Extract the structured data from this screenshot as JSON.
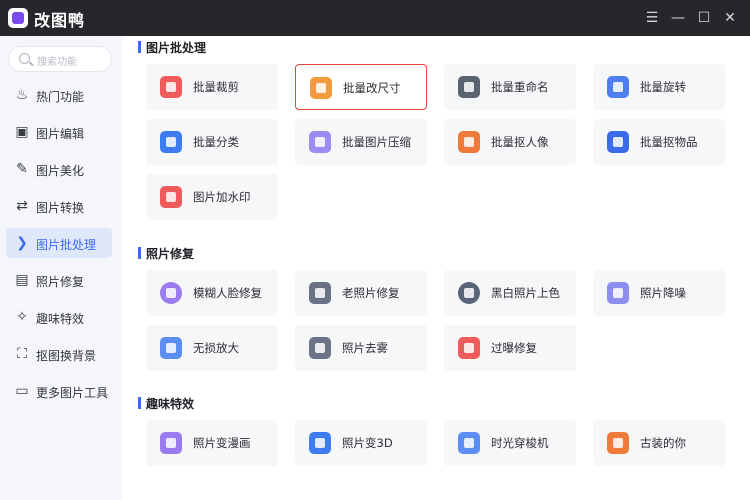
{
  "app": {
    "title": "改图鸭"
  },
  "window_controls": {
    "menu": "☰",
    "minimize": "—",
    "maximize": "☐",
    "close": "✕"
  },
  "search": {
    "placeholder": "搜索功能"
  },
  "sidebar": {
    "items": [
      {
        "label": "热门功能",
        "icon": "fire-icon",
        "glyph": "♨"
      },
      {
        "label": "图片编辑",
        "icon": "image-edit-icon",
        "glyph": "▣"
      },
      {
        "label": "图片美化",
        "icon": "image-beautify-icon",
        "glyph": "✎"
      },
      {
        "label": "图片转换",
        "icon": "image-convert-icon",
        "glyph": "⇄"
      },
      {
        "label": "图片批处理",
        "icon": "batch-icon",
        "glyph": "❯",
        "active": true
      },
      {
        "label": "照片修复",
        "icon": "photo-repair-icon",
        "glyph": "▤"
      },
      {
        "label": "趣味特效",
        "icon": "magic-wand-icon",
        "glyph": "✧"
      },
      {
        "label": "抠图换背景",
        "icon": "cutout-icon",
        "glyph": "⛶"
      },
      {
        "label": "更多图片工具",
        "icon": "toolbox-icon",
        "glyph": "▭"
      }
    ]
  },
  "sections": [
    {
      "title": "图片批处理",
      "cards": [
        {
          "label": "批量裁剪",
          "icon": "batch-crop-icon",
          "color": "#ef5a5a"
        },
        {
          "label": "批量改尺寸",
          "icon": "batch-resize-icon",
          "color": "#f39a3d",
          "selected": true
        },
        {
          "label": "批量重命名",
          "icon": "batch-rename-icon",
          "color": "#5b6270"
        },
        {
          "label": "批量旋转",
          "icon": "batch-rotate-icon",
          "color": "#4f7df2"
        },
        {
          "label": "批量分类",
          "icon": "batch-classify-icon",
          "color": "#3d7cf0"
        },
        {
          "label": "批量图片压缩",
          "icon": "batch-compress-icon",
          "color": "#9a8cf0"
        },
        {
          "label": "批量抠人像",
          "icon": "batch-portrait-cutout-icon",
          "color": "#f07a3a"
        },
        {
          "label": "批量抠物品",
          "icon": "batch-object-cutout-icon",
          "color": "#3b6be8"
        },
        {
          "label": "图片加水印",
          "icon": "watermark-icon",
          "color": "#ef5a5a"
        }
      ]
    },
    {
      "title": "照片修复",
      "cards": [
        {
          "label": "模糊人脸修复",
          "icon": "face-repair-icon",
          "color": "#9b7cf0"
        },
        {
          "label": "老照片修复",
          "icon": "old-photo-repair-icon",
          "color": "#6b7286"
        },
        {
          "label": "黑白照片上色",
          "icon": "colorize-icon",
          "color": "#5a6478"
        },
        {
          "label": "照片降噪",
          "icon": "denoise-icon",
          "color": "#8d8ff0"
        },
        {
          "label": "无损放大",
          "icon": "upscale-icon",
          "color": "#5b8df2"
        },
        {
          "label": "照片去雾",
          "icon": "dehaze-icon",
          "color": "#6b7286"
        },
        {
          "label": "过曝修复",
          "icon": "overexposure-icon",
          "color": "#ef5a5a"
        }
      ]
    },
    {
      "title": "趣味特效",
      "cards": [
        {
          "label": "照片变漫画",
          "icon": "cartoon-icon",
          "color": "#9b7cf0"
        },
        {
          "label": "照片变3D",
          "icon": "photo-3d-icon",
          "color": "#3d7cf0"
        },
        {
          "label": "时光穿梭机",
          "icon": "time-machine-icon",
          "color": "#5b8df2"
        },
        {
          "label": "古装的你",
          "icon": "ancient-costume-icon",
          "color": "#f07a3a"
        }
      ]
    }
  ]
}
